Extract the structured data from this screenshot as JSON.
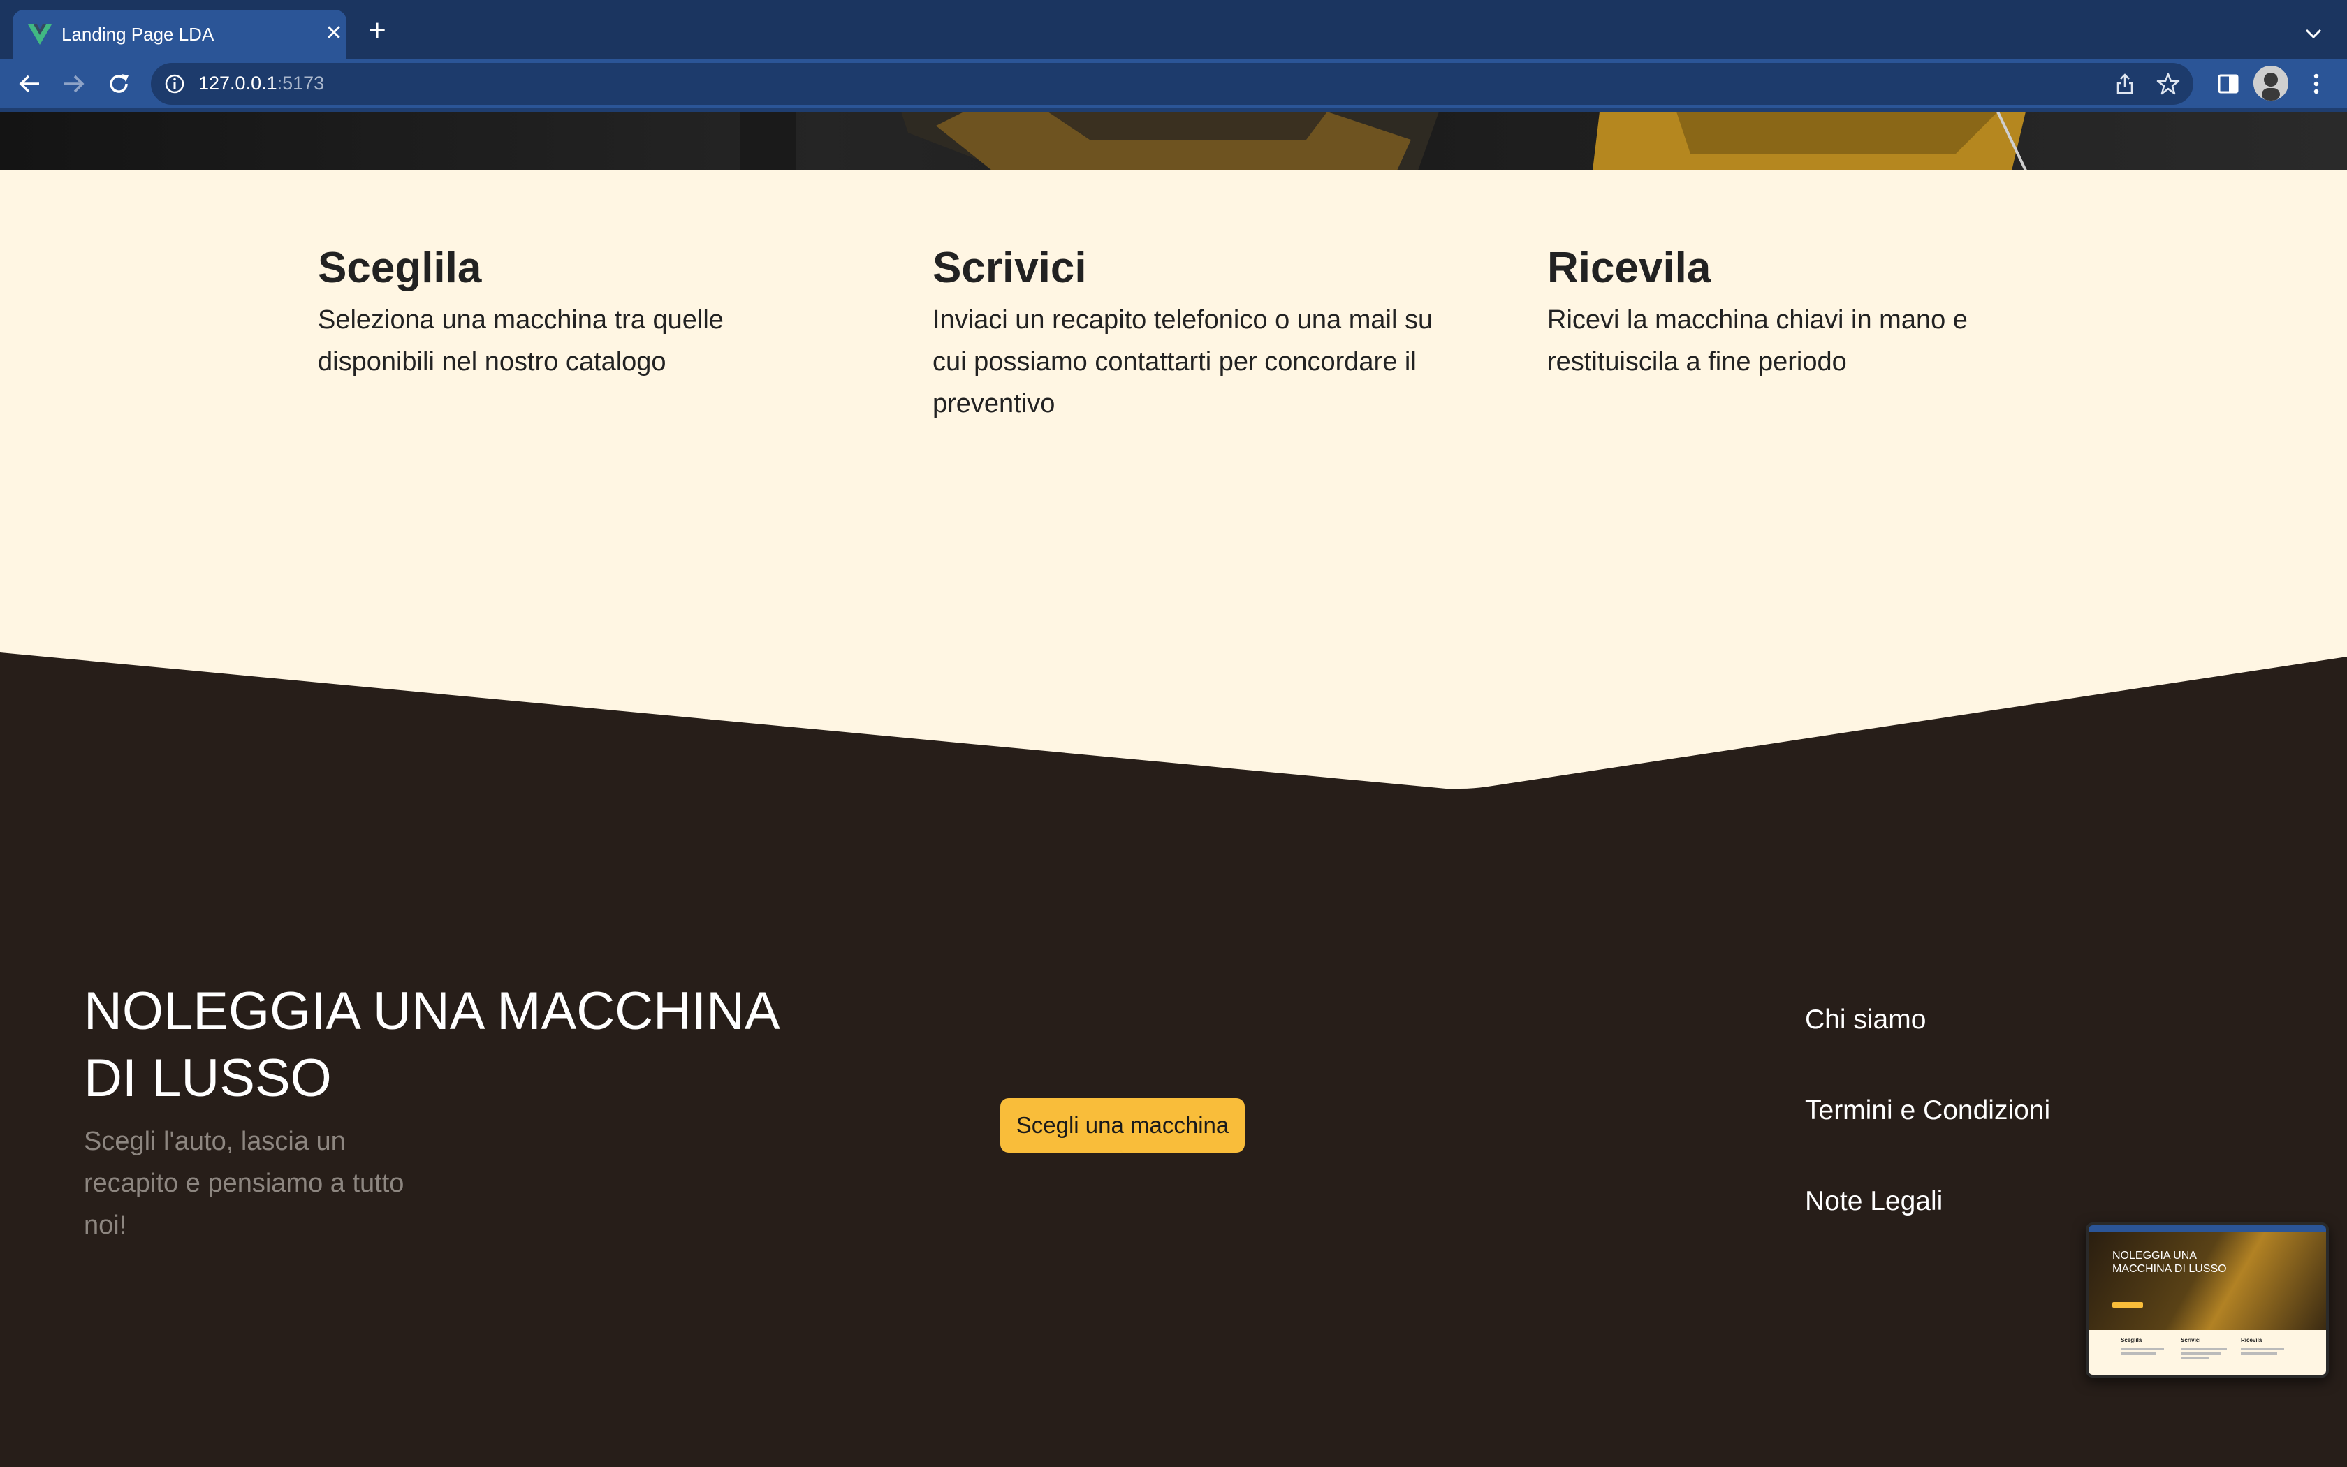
{
  "browser": {
    "tab_title": "Landing Page LDA",
    "tab_close_icon": "close-icon",
    "new_tab_symbol": "+",
    "url_host": "127.0.0.1",
    "url_port": ":5173"
  },
  "steps": [
    {
      "title": "Sceglila",
      "text": "Seleziona una macchina tra quelle disponibili nel nostro catalogo"
    },
    {
      "title": "Scrivici",
      "text": "Inviaci un recapito telefonico o una mail su cui possiamo contattarti per concordare il preventivo"
    },
    {
      "title": "Ricevila",
      "text": "Ricevi la macchina chiavi in mano e restituiscila a fine periodo"
    }
  ],
  "footer": {
    "title": "NOLEGGIA UNA MACCHINA DI LUSSO",
    "subtitle": "Scegli l'auto, lascia un recapito e pensiamo a tutto noi!",
    "cta_label": "Scegli una macchina",
    "links": [
      "Chi siamo",
      "Termini e Condizioni",
      "Note Legali"
    ]
  },
  "preview": {
    "hero_title": "NOLEGGIA UNA MACCHINA DI LUSSO",
    "steps": [
      "Sceglila",
      "Scrivici",
      "Ricevila"
    ]
  },
  "colors": {
    "browser_frame": "#1b3560",
    "browser_tab": "#2b5597",
    "steps_bg": "#fff6e3",
    "footer_bg": "#271e19",
    "cta_bg": "#f9bd3a",
    "subtitle_text": "#8d8680"
  }
}
